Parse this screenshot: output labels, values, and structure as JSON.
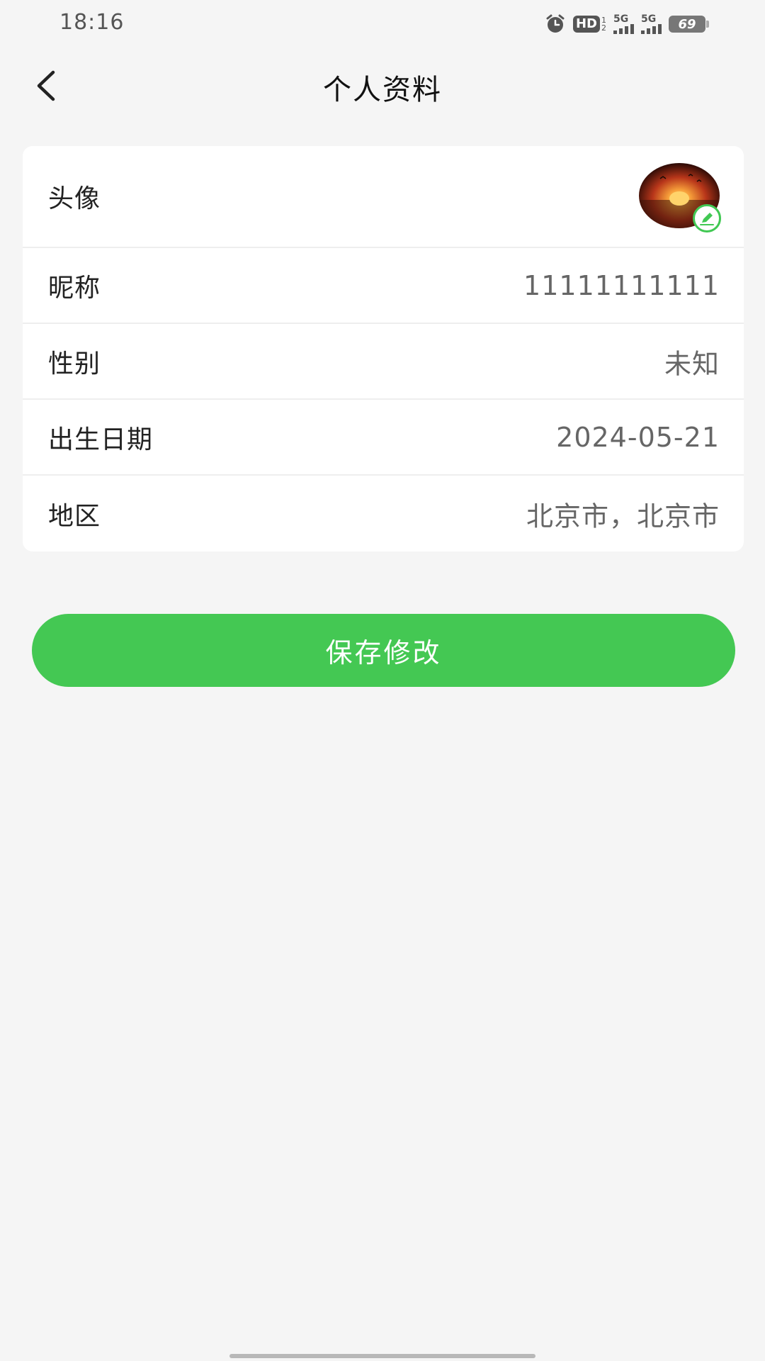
{
  "status_bar": {
    "time": "18:16",
    "hd_label": "HD",
    "hd_sub_top": "1",
    "hd_sub_bottom": "2",
    "signal1_label": "5G",
    "signal2_label": "5G",
    "battery_level": "69",
    "icons": [
      "alarm-icon",
      "hd-icon",
      "signal-icon",
      "signal-icon",
      "battery-icon"
    ]
  },
  "header": {
    "title": "个人资料",
    "back_icon": "chevron-left-icon"
  },
  "profile": {
    "avatar_label": "头像",
    "nickname_label": "昵称",
    "nickname_value": "11111111111",
    "gender_label": "性别",
    "gender_value": "未知",
    "birthday_label": "出生日期",
    "birthday_value": "2024-05-21",
    "region_label": "地区",
    "region_value": "北京市，北京市"
  },
  "actions": {
    "save_label": "保存修改"
  },
  "colors": {
    "accent": "#44c853",
    "background": "#f5f5f5",
    "card": "#ffffff"
  }
}
